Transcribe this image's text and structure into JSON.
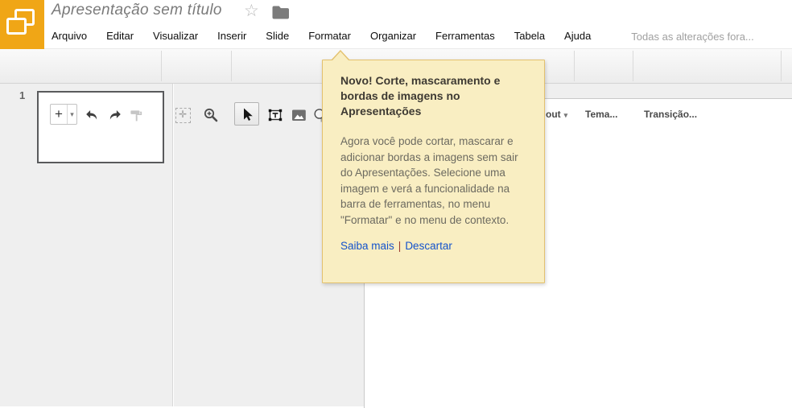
{
  "header": {
    "title": "Apresentação sem título",
    "menu": [
      "Arquivo",
      "Editar",
      "Visualizar",
      "Inserir",
      "Slide",
      "Formatar",
      "Organizar",
      "Ferramentas",
      "Tabela",
      "Ajuda"
    ],
    "status": "Todas as alterações fora..."
  },
  "toolbar": {
    "new_slide": "+",
    "caret": "▾",
    "fit_glyph": "✛",
    "layout_partial": "out",
    "theme": "Tema...",
    "transition": "Transição..."
  },
  "filmstrip": {
    "slide_number": "1"
  },
  "promo": {
    "heading": "Novo! Corte, mascaramento e bordas de imagens no Apresentações",
    "body": "Agora você pode cortar, mascarar e adicionar bordas a imagens sem sair do Apresentações. Selecione uma imagem e verá a funcionalidade na barra de ferramentas, no menu \"Formatar\" e no menu de contexto.",
    "learn_more": "Saiba mais",
    "separator": "|",
    "dismiss": "Descartar"
  },
  "icons": {
    "star": "☆"
  },
  "colors": {
    "logo": "#F0A616",
    "promo_bg": "#F9EEC2",
    "promo_border": "#E3C16E",
    "link": "#1352CC"
  }
}
